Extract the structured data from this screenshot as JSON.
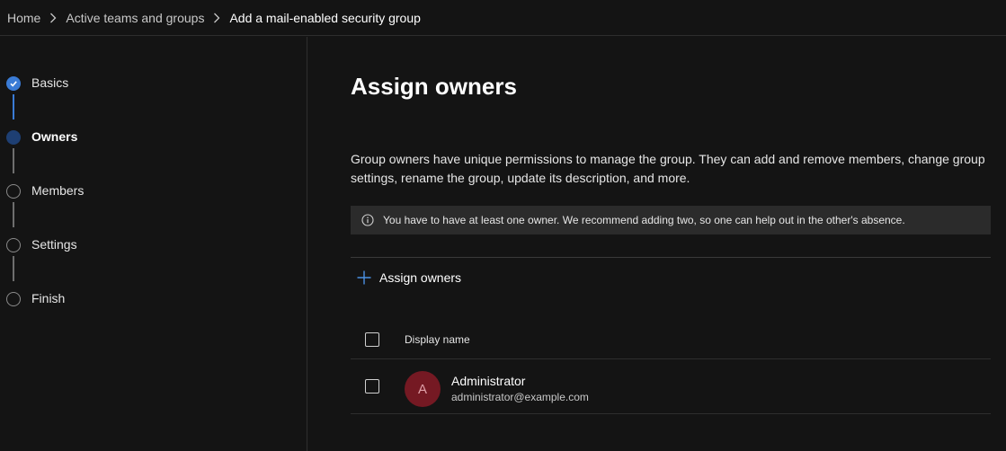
{
  "breadcrumb": {
    "items": [
      "Home",
      "Active teams and groups",
      "Add a mail-enabled security group"
    ]
  },
  "wizard": {
    "steps": [
      {
        "label": "Basics",
        "state": "completed"
      },
      {
        "label": "Owners",
        "state": "current"
      },
      {
        "label": "Members",
        "state": "pending"
      },
      {
        "label": "Settings",
        "state": "pending"
      },
      {
        "label": "Finish",
        "state": "pending"
      }
    ]
  },
  "main": {
    "title": "Assign owners",
    "description": "Group owners have unique permissions to manage the group. They can add and remove members, change group settings, rename the group, update its description, and more.",
    "info_message": "You have to have at least one owner. We recommend adding two, so one can help out in the other's absence.",
    "assign_button": "Assign owners"
  },
  "table": {
    "columns": [
      "Display name"
    ],
    "rows": [
      {
        "initial": "A",
        "name": "Administrator",
        "email": "administrator@example.com"
      }
    ]
  },
  "colors": {
    "accent": "#3a7bd5",
    "avatar_bg": "#751923",
    "background": "#141414"
  },
  "icons": [
    "chevron-right-icon",
    "checkmark-icon",
    "info-icon",
    "add-icon"
  ]
}
